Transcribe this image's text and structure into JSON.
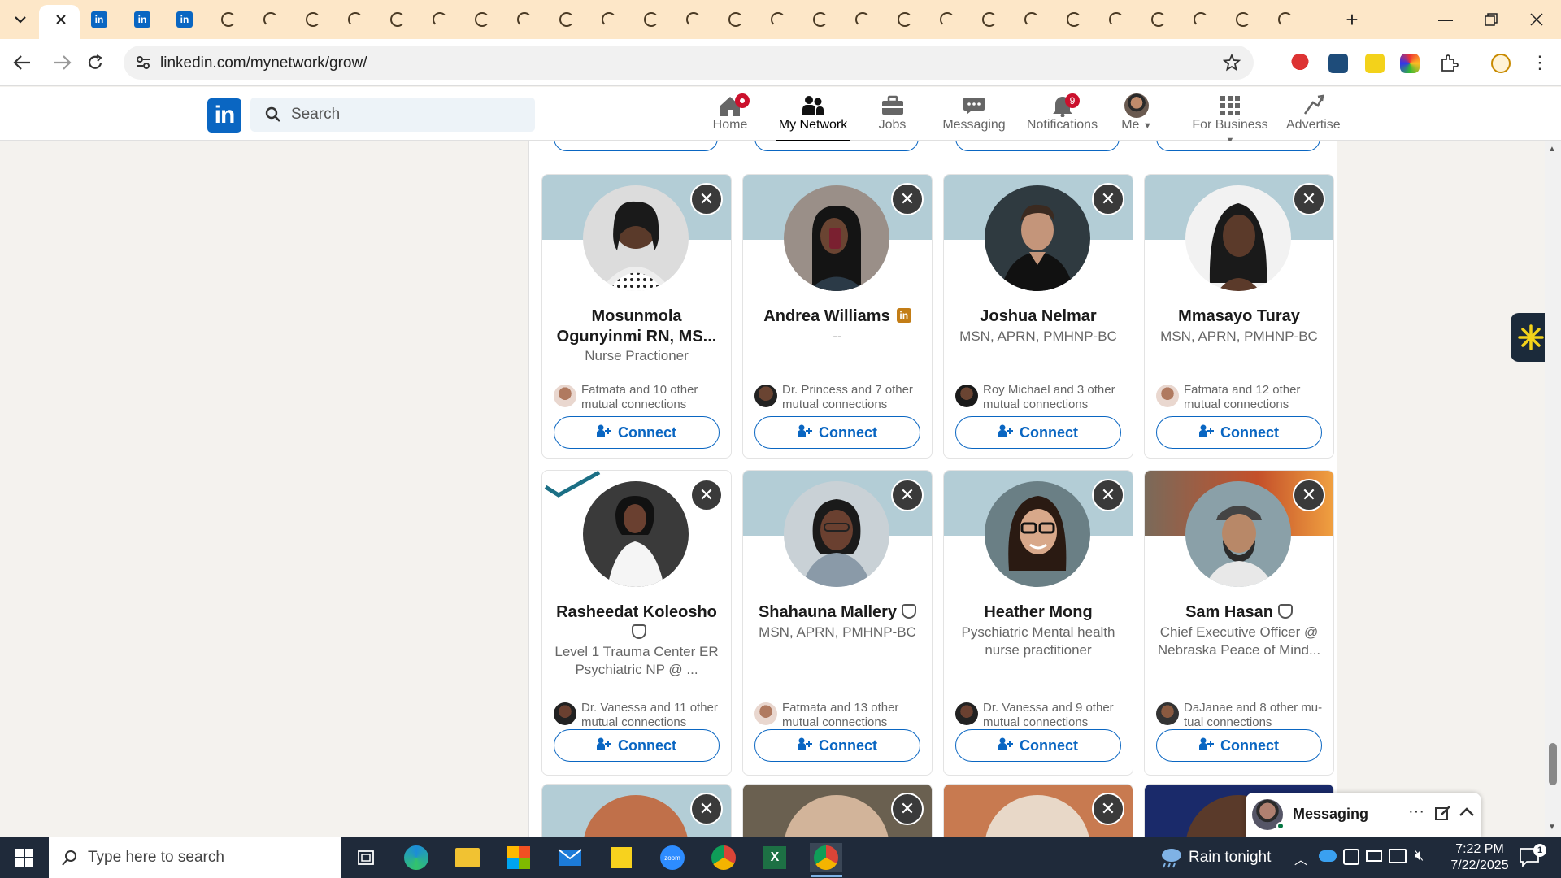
{
  "browser": {
    "url": "linkedin.com/mynetwork/grow/",
    "tab_count_icons": [
      "linkedin-icon",
      "linkedin-icon",
      "linkedin-icon"
    ]
  },
  "linkedin": {
    "search_placeholder": "Search",
    "nav": [
      {
        "key": "home",
        "label": "Home",
        "badge": ""
      },
      {
        "key": "network",
        "label": "My Network",
        "badge": ""
      },
      {
        "key": "jobs",
        "label": "Jobs",
        "badge": ""
      },
      {
        "key": "messaging",
        "label": "Messaging",
        "badge": ""
      },
      {
        "key": "notifications",
        "label": "Notifications",
        "badge": "9"
      },
      {
        "key": "me",
        "label": "Me",
        "badge": ""
      },
      {
        "key": "business",
        "label": "For Business",
        "badge": ""
      },
      {
        "key": "advertise",
        "label": "Advertise",
        "badge": ""
      }
    ]
  },
  "cards": [
    {
      "name": "Mosunmola Ogunyinmi RN, MS...",
      "title": "Nurse Practioner",
      "mutual": "Fatmata and 10 other mutual connections",
      "badge": "",
      "banner": "#b3cdd6",
      "connect": "Connect"
    },
    {
      "name": "Andrea Williams",
      "title": "--",
      "mutual": "Dr. Princess and 7 other mutual connections",
      "badge": "in",
      "banner": "#b3cdd6",
      "connect": "Connect"
    },
    {
      "name": "Joshua Nelmar",
      "title": "MSN, APRN, PMHNP-BC",
      "mutual": "Roy Michael and 3 other mutual connections",
      "badge": "",
      "banner": "#b3cdd6",
      "connect": "Connect"
    },
    {
      "name": "Mmasayo Turay",
      "title": "MSN, APRN, PMHNP-BC",
      "mutual": "Fatmata and 12 other mutual connections",
      "badge": "",
      "banner": "#b3cdd6",
      "connect": "Connect"
    },
    {
      "name": "Rasheedat Koleosho",
      "title": "Level 1 Trauma Center ER Psychiatric NP @ ...",
      "mutual": "Dr. Vanessa and 11 other mutual connections",
      "badge": "verified",
      "banner": "#ffffff",
      "connect": "Connect"
    },
    {
      "name": "Shahauna Mallery",
      "title": "MSN, APRN, PMHNP-BC",
      "mutual": "Fatmata and 13 other mutual connections",
      "badge": "verified",
      "banner": "#b3cdd6",
      "connect": "Connect"
    },
    {
      "name": "Heather Mong",
      "title": "Pyschiatric Mental health nurse practitioner",
      "mutual": "Dr. Vanessa and 9 other mutual connections",
      "badge": "",
      "banner": "#b3cdd6",
      "connect": "Connect"
    },
    {
      "name": "Sam Hasan",
      "title": "Chief Executive Officer @ Nebraska Peace of Mind...",
      "mutual": "DaJanae and 8 other mu-tual connections",
      "badge": "verified",
      "banner": "#c4502a",
      "connect": "Connect"
    }
  ],
  "messaging": {
    "label": "Messaging"
  },
  "taskbar": {
    "search_placeholder": "Type here to search",
    "weather": "Rain tonight",
    "time": "7:22 PM",
    "date": "7/22/2025"
  }
}
